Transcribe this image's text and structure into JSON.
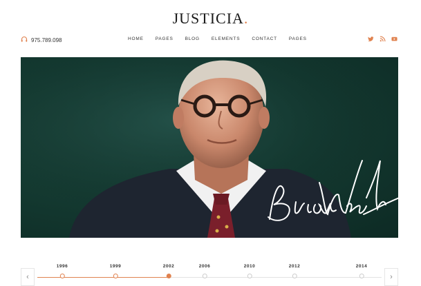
{
  "brand": {
    "name": "JUSTICIA",
    "dot": ".",
    "accent": "#e0824f"
  },
  "header": {
    "phone": "975.789.098",
    "nav": [
      "HOME",
      "PAGES",
      "BLOG",
      "ELEMENTS",
      "CONTACT",
      "PAGES"
    ],
    "social": [
      "twitter-icon",
      "rss-icon",
      "youtube-icon"
    ]
  },
  "hero": {
    "signature": "Brian Wright",
    "background": "#143a31"
  },
  "timeline": {
    "years": [
      "1996",
      "1999",
      "2002",
      "2006",
      "2010",
      "2012",
      "2014"
    ],
    "active_index": 2,
    "prev_arrow": "‹",
    "next_arrow": "›"
  }
}
